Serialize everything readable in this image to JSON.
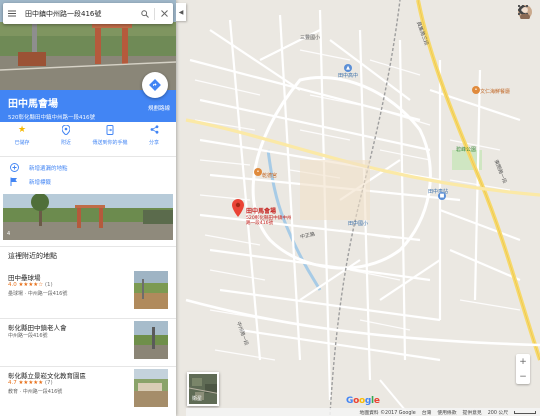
{
  "search": {
    "query": "田中鎮中州路一段416號"
  },
  "place": {
    "name": "田中馬會場",
    "address": "520彰化縣田中鎮中州路一段416號",
    "directions_label": "規劃路線",
    "actions": [
      {
        "label": "已儲存",
        "icon": "star-icon"
      },
      {
        "label": "附近",
        "icon": "nearby-icon"
      },
      {
        "label": "傳送到你的手機",
        "icon": "send-to-phone-icon"
      },
      {
        "label": "分享",
        "icon": "share-icon"
      }
    ],
    "add_missing_place": "新增遺漏的地點",
    "add_label": "新增標籤",
    "photo_count": "4"
  },
  "nearby": {
    "heading": "這裡附近的地點",
    "items": [
      {
        "name": "田中壘球場",
        "rating": "4.0",
        "stars": "★★★★☆",
        "count": "(1)",
        "sub": "壘球場 · 中州路一段416號"
      },
      {
        "name": "彰化縣田中鎮老人會",
        "rating": "",
        "stars": "",
        "count": "",
        "sub": "中州路一段416號"
      },
      {
        "name": "彰化縣立景崧文化教育園區",
        "rating": "4.7",
        "stars": "★★★★★",
        "count": "(7)",
        "sub": "教育 · 中州路一段416號"
      }
    ]
  },
  "map": {
    "pin_label_title": "田中馬會場",
    "pin_label_addr1": "520彰化縣田中鎮中州",
    "pin_label_addr2": "路一段416號",
    "labels": {
      "sanmin": "三豐國小",
      "tianzhong_high": "田中高中",
      "wenren": "文仁海鮮餐廳",
      "bifeng_park": "碧峰公園",
      "tianzhong_elem": "田中國小",
      "station": "田中車站",
      "tianzhong_station": "田中車站",
      "bao_temple": "乾德宮",
      "zhongzheng": "中正路",
      "zhongzhou": "中州路一段",
      "yuanlin": "員集路三段",
      "dongzhou": "東閔路一段"
    },
    "satellite_label": "衛星",
    "google": "Google",
    "footer": {
      "copyright": "地圖資料 ©2017 Google",
      "taiwan": "台灣",
      "terms": "使用條款",
      "send": "提供意見",
      "scale": "200 公尺"
    }
  },
  "colors": {
    "accent": "#4285f4",
    "pin": "#ea4335",
    "map_bg": "#ebe8e2",
    "highway": "#f7d96b",
    "river": "#a7cbe6"
  }
}
